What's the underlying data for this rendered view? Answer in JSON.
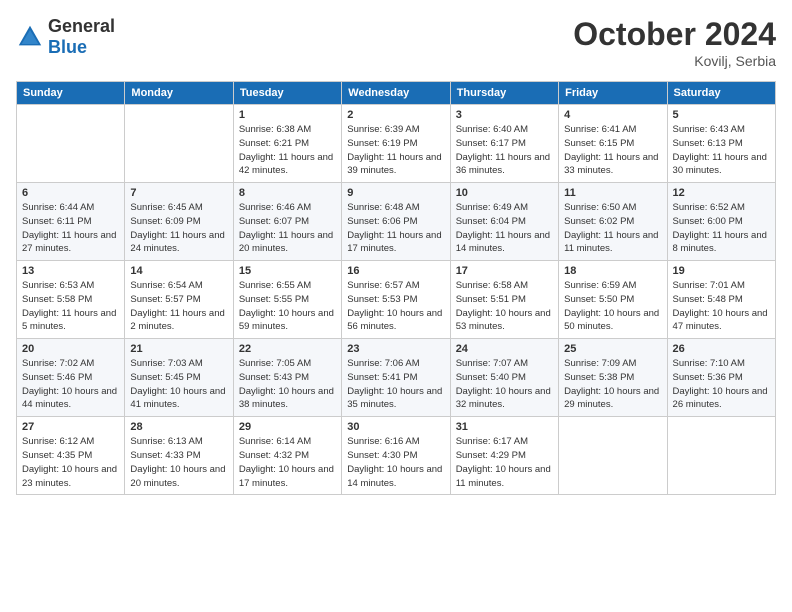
{
  "header": {
    "logo_general": "General",
    "logo_blue": "Blue",
    "month_year": "October 2024",
    "location": "Kovilj, Serbia"
  },
  "weekdays": [
    "Sunday",
    "Monday",
    "Tuesday",
    "Wednesday",
    "Thursday",
    "Friday",
    "Saturday"
  ],
  "weeks": [
    [
      {
        "day": "",
        "info": ""
      },
      {
        "day": "",
        "info": ""
      },
      {
        "day": "1",
        "info": "Sunrise: 6:38 AM\nSunset: 6:21 PM\nDaylight: 11 hours and 42 minutes."
      },
      {
        "day": "2",
        "info": "Sunrise: 6:39 AM\nSunset: 6:19 PM\nDaylight: 11 hours and 39 minutes."
      },
      {
        "day": "3",
        "info": "Sunrise: 6:40 AM\nSunset: 6:17 PM\nDaylight: 11 hours and 36 minutes."
      },
      {
        "day": "4",
        "info": "Sunrise: 6:41 AM\nSunset: 6:15 PM\nDaylight: 11 hours and 33 minutes."
      },
      {
        "day": "5",
        "info": "Sunrise: 6:43 AM\nSunset: 6:13 PM\nDaylight: 11 hours and 30 minutes."
      }
    ],
    [
      {
        "day": "6",
        "info": "Sunrise: 6:44 AM\nSunset: 6:11 PM\nDaylight: 11 hours and 27 minutes."
      },
      {
        "day": "7",
        "info": "Sunrise: 6:45 AM\nSunset: 6:09 PM\nDaylight: 11 hours and 24 minutes."
      },
      {
        "day": "8",
        "info": "Sunrise: 6:46 AM\nSunset: 6:07 PM\nDaylight: 11 hours and 20 minutes."
      },
      {
        "day": "9",
        "info": "Sunrise: 6:48 AM\nSunset: 6:06 PM\nDaylight: 11 hours and 17 minutes."
      },
      {
        "day": "10",
        "info": "Sunrise: 6:49 AM\nSunset: 6:04 PM\nDaylight: 11 hours and 14 minutes."
      },
      {
        "day": "11",
        "info": "Sunrise: 6:50 AM\nSunset: 6:02 PM\nDaylight: 11 hours and 11 minutes."
      },
      {
        "day": "12",
        "info": "Sunrise: 6:52 AM\nSunset: 6:00 PM\nDaylight: 11 hours and 8 minutes."
      }
    ],
    [
      {
        "day": "13",
        "info": "Sunrise: 6:53 AM\nSunset: 5:58 PM\nDaylight: 11 hours and 5 minutes."
      },
      {
        "day": "14",
        "info": "Sunrise: 6:54 AM\nSunset: 5:57 PM\nDaylight: 11 hours and 2 minutes."
      },
      {
        "day": "15",
        "info": "Sunrise: 6:55 AM\nSunset: 5:55 PM\nDaylight: 10 hours and 59 minutes."
      },
      {
        "day": "16",
        "info": "Sunrise: 6:57 AM\nSunset: 5:53 PM\nDaylight: 10 hours and 56 minutes."
      },
      {
        "day": "17",
        "info": "Sunrise: 6:58 AM\nSunset: 5:51 PM\nDaylight: 10 hours and 53 minutes."
      },
      {
        "day": "18",
        "info": "Sunrise: 6:59 AM\nSunset: 5:50 PM\nDaylight: 10 hours and 50 minutes."
      },
      {
        "day": "19",
        "info": "Sunrise: 7:01 AM\nSunset: 5:48 PM\nDaylight: 10 hours and 47 minutes."
      }
    ],
    [
      {
        "day": "20",
        "info": "Sunrise: 7:02 AM\nSunset: 5:46 PM\nDaylight: 10 hours and 44 minutes."
      },
      {
        "day": "21",
        "info": "Sunrise: 7:03 AM\nSunset: 5:45 PM\nDaylight: 10 hours and 41 minutes."
      },
      {
        "day": "22",
        "info": "Sunrise: 7:05 AM\nSunset: 5:43 PM\nDaylight: 10 hours and 38 minutes."
      },
      {
        "day": "23",
        "info": "Sunrise: 7:06 AM\nSunset: 5:41 PM\nDaylight: 10 hours and 35 minutes."
      },
      {
        "day": "24",
        "info": "Sunrise: 7:07 AM\nSunset: 5:40 PM\nDaylight: 10 hours and 32 minutes."
      },
      {
        "day": "25",
        "info": "Sunrise: 7:09 AM\nSunset: 5:38 PM\nDaylight: 10 hours and 29 minutes."
      },
      {
        "day": "26",
        "info": "Sunrise: 7:10 AM\nSunset: 5:36 PM\nDaylight: 10 hours and 26 minutes."
      }
    ],
    [
      {
        "day": "27",
        "info": "Sunrise: 6:12 AM\nSunset: 4:35 PM\nDaylight: 10 hours and 23 minutes."
      },
      {
        "day": "28",
        "info": "Sunrise: 6:13 AM\nSunset: 4:33 PM\nDaylight: 10 hours and 20 minutes."
      },
      {
        "day": "29",
        "info": "Sunrise: 6:14 AM\nSunset: 4:32 PM\nDaylight: 10 hours and 17 minutes."
      },
      {
        "day": "30",
        "info": "Sunrise: 6:16 AM\nSunset: 4:30 PM\nDaylight: 10 hours and 14 minutes."
      },
      {
        "day": "31",
        "info": "Sunrise: 6:17 AM\nSunset: 4:29 PM\nDaylight: 10 hours and 11 minutes."
      },
      {
        "day": "",
        "info": ""
      },
      {
        "day": "",
        "info": ""
      }
    ]
  ]
}
